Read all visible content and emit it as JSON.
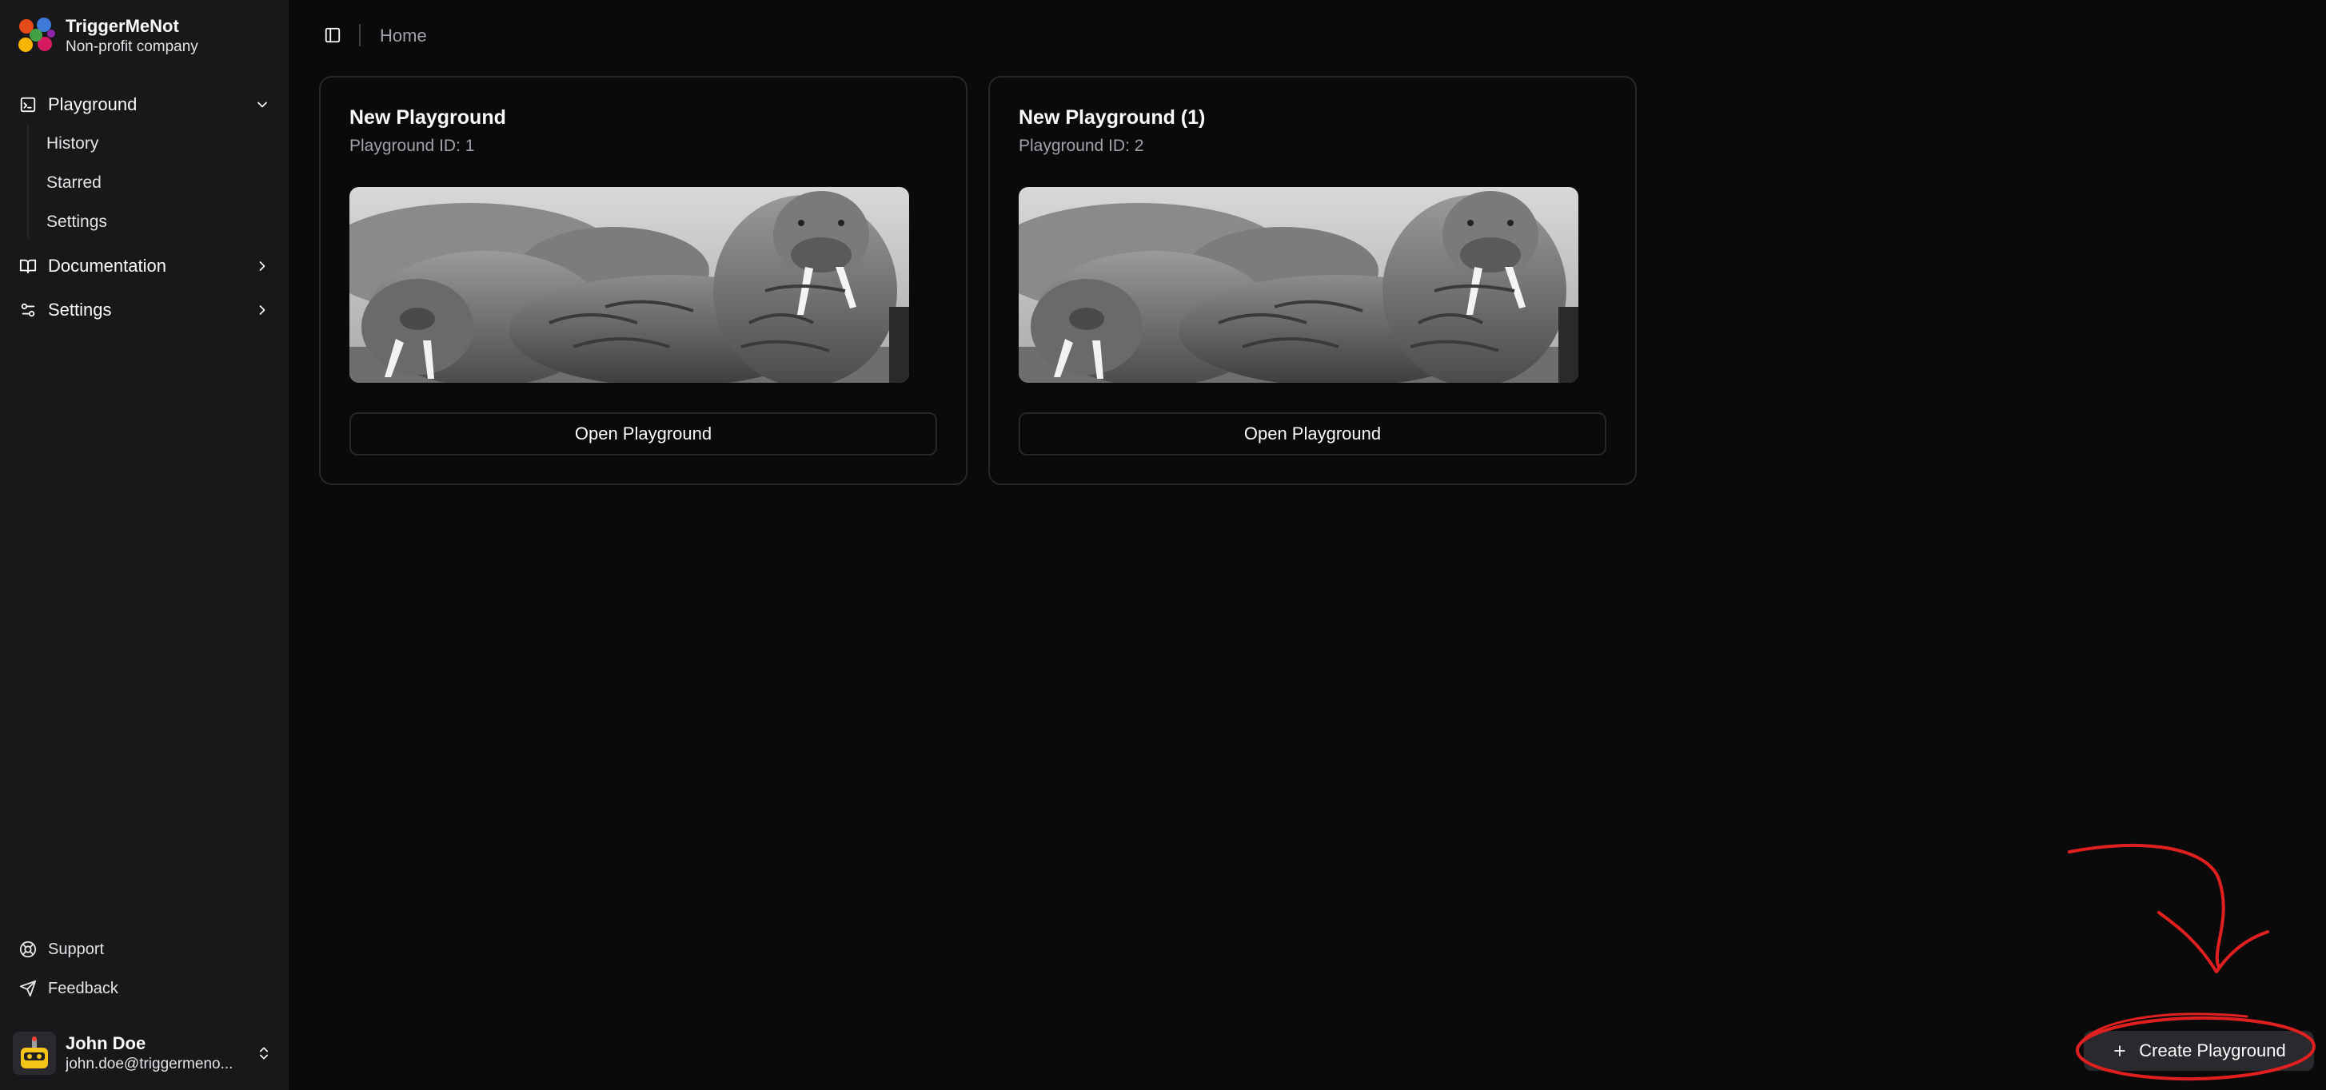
{
  "brand": {
    "name": "TriggerMeNot",
    "subtitle": "Non-profit company"
  },
  "sidebar": {
    "nav": [
      {
        "label": "Playground",
        "icon": "terminal-square-icon",
        "expanded": true,
        "children": [
          "History",
          "Starred",
          "Settings"
        ]
      },
      {
        "label": "Documentation",
        "icon": "book-open-icon",
        "expanded": false
      },
      {
        "label": "Settings",
        "icon": "sliders-icon",
        "expanded": false
      }
    ],
    "footer": [
      {
        "label": "Support",
        "icon": "life-buoy-icon"
      },
      {
        "label": "Feedback",
        "icon": "send-icon"
      }
    ],
    "user": {
      "name": "John Doe",
      "email": "john.doe@triggermeno..."
    }
  },
  "topbar": {
    "breadcrumb": "Home"
  },
  "cards": [
    {
      "title": "New Playground",
      "subtitle": "Playground ID: 1",
      "button": "Open Playground",
      "image": "walrus-photo"
    },
    {
      "title": "New Playground (1)",
      "subtitle": "Playground ID: 2",
      "button": "Open Playground",
      "image": "walrus-photo"
    }
  ],
  "create_button": {
    "label": "Create Playground"
  },
  "colors": {
    "background": "#0a0a0b",
    "sidebar": "#18181b",
    "border": "#27272a",
    "muted_text": "#a1a1aa",
    "annotation": "#e02020"
  }
}
